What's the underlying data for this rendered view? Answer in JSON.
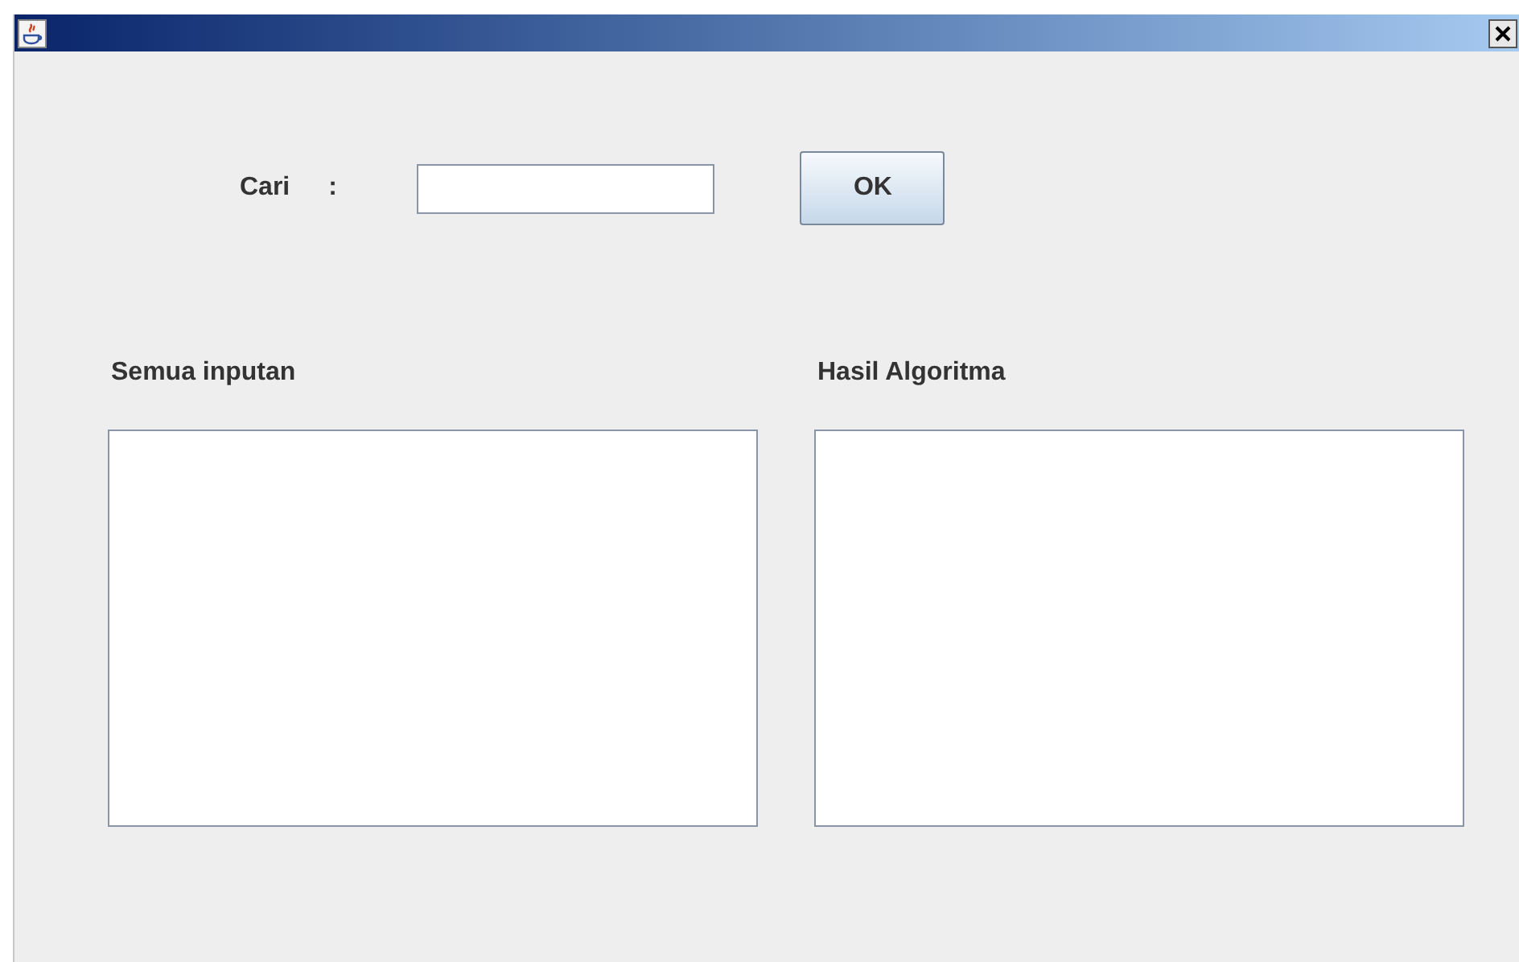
{
  "search": {
    "label": "Cari",
    "separator": ":",
    "button": "OK"
  },
  "panels": [
    {
      "title": "Semua inputan"
    },
    {
      "title": "Hasil Algoritma"
    }
  ]
}
